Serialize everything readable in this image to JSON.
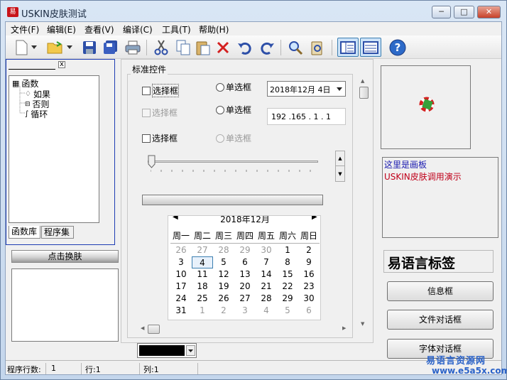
{
  "window": {
    "title": "USKIN皮肤测试",
    "icon_text": "易"
  },
  "menu": [
    "文件(F)",
    "编辑(E)",
    "查看(V)",
    "编译(C)",
    "工具(T)",
    "帮助(H)"
  ],
  "toolbar": [
    "new-icon",
    "new-dropdown-icon",
    "open-icon",
    "open-dropdown-icon",
    "save-icon",
    "save-all-icon",
    "print-icon",
    "cut-icon",
    "copy-icon",
    "paste-icon",
    "delete-icon",
    "undo-icon",
    "redo-icon",
    "find-icon",
    "replace-icon",
    "view1-icon",
    "view2-icon",
    "help-icon"
  ],
  "lib": {
    "tree": [
      "函数",
      "如果",
      "否则",
      "循环"
    ],
    "tabs": [
      "函数库",
      "程序集"
    ],
    "skin_button": "点击换肤"
  },
  "controls": {
    "group_label": "标准控件",
    "check1": "选择框",
    "check2": "选择框",
    "check3": "选择框",
    "radio1": "单选框",
    "radio2": "单选框",
    "radio3": "单选框",
    "date": "2018年12月  4日",
    "ip": "192 .165 . 1   . 1"
  },
  "calendar": {
    "month": "2018年12月",
    "weekdays": [
      "周一",
      "周二",
      "周三",
      "周四",
      "周五",
      "周六",
      "周日"
    ],
    "rows": [
      [
        "26",
        "27",
        "28",
        "29",
        "30",
        "1",
        "2"
      ],
      [
        "3",
        "4",
        "5",
        "6",
        "7",
        "8",
        "9"
      ],
      [
        "10",
        "11",
        "12",
        "13",
        "14",
        "15",
        "16"
      ],
      [
        "17",
        "18",
        "19",
        "20",
        "21",
        "22",
        "23"
      ],
      [
        "24",
        "25",
        "26",
        "27",
        "28",
        "29",
        "30"
      ],
      [
        "31",
        "1",
        "2",
        "3",
        "4",
        "5",
        "6"
      ]
    ],
    "selected": "4"
  },
  "right": {
    "text_line1": "这里是画板",
    "text_line2": "USKIN皮肤调用演示",
    "label": "易语言标签",
    "buttons": [
      "信息框",
      "文件对话框",
      "字体对话框"
    ]
  },
  "status": {
    "lines_label": "程序行数:",
    "lines": "1",
    "row": "行:1",
    "col": "列:1"
  },
  "watermark": {
    "line1": "易语言资源网",
    "line2": "www.e5a5x.com"
  },
  "colors": {
    "accent": "#1d3cb3",
    "text_blue": "#1a1ab0",
    "text_red": "#c0001a"
  }
}
